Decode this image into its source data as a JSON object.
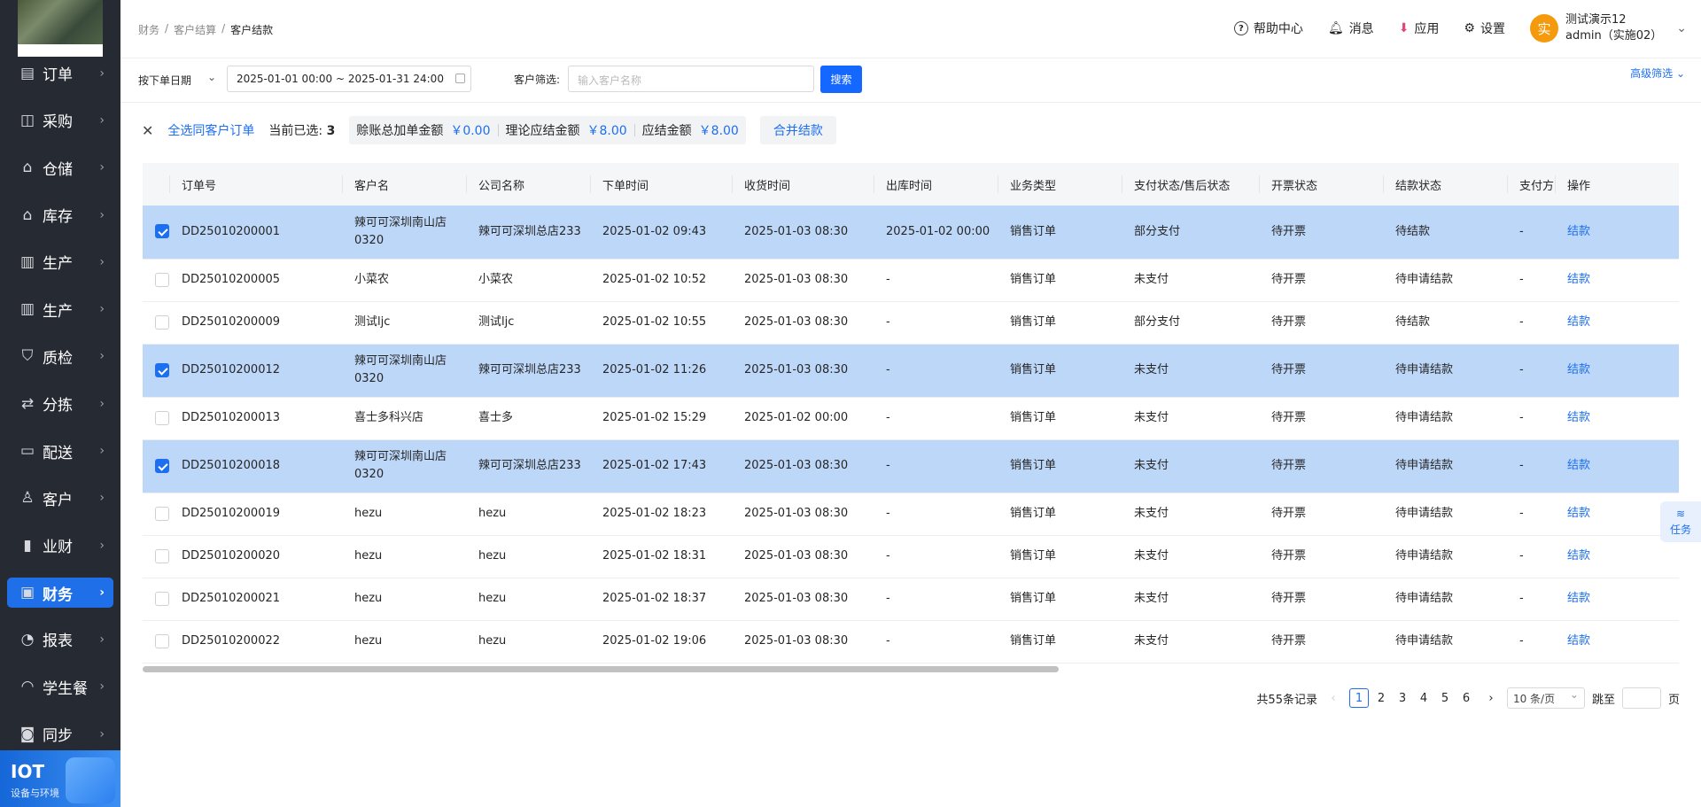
{
  "sidebar": {
    "items": [
      {
        "label": "订单",
        "icon": "clipboard-icon"
      },
      {
        "label": "采购",
        "icon": "shopping-bag-icon"
      },
      {
        "label": "仓储",
        "icon": "warehouse-icon"
      },
      {
        "label": "库存",
        "icon": "inventory-icon"
      },
      {
        "label": "生产",
        "icon": "factory-icon"
      },
      {
        "label": "生产",
        "icon": "factory-icon"
      },
      {
        "label": "质检",
        "icon": "shield-icon"
      },
      {
        "label": "分拣",
        "icon": "sort-icon"
      },
      {
        "label": "配送",
        "icon": "truck-icon"
      },
      {
        "label": "客户",
        "icon": "user-icon"
      },
      {
        "label": "业财",
        "icon": "chart-icon"
      },
      {
        "label": "财务",
        "icon": "wallet-icon",
        "active": true
      },
      {
        "label": "报表",
        "icon": "pie-icon"
      },
      {
        "label": "学生餐",
        "icon": "dish-icon"
      },
      {
        "label": "同步",
        "icon": "sync-icon"
      }
    ],
    "iot_title": "IOT",
    "iot_sub": "设备与环境"
  },
  "breadcrumb": [
    "财务",
    "客户结算",
    "客户结款"
  ],
  "header": {
    "help": "帮助中心",
    "messages": "消息",
    "apps": "应用",
    "settings": "设置",
    "avatar_char": "实",
    "user_name": "测试演示12",
    "user_role": "admin（实施02）"
  },
  "filters": {
    "date_type": "按下单日期",
    "date_range": "2025-01-01 00:00 ~ 2025-01-31 24:00",
    "customer_label": "客户筛选:",
    "customer_placeholder": "输入客户名称",
    "search": "搜索",
    "advanced": "高级筛选"
  },
  "selection": {
    "select_all": "全选同客户订单",
    "current_label": "当前已选:",
    "current_count": "3",
    "total_add_label": "赊账总加单金额",
    "total_add_value": "￥0.00",
    "theory_label": "理论应结金额",
    "theory_value": "￥8.00",
    "due_label": "应结金额",
    "due_value": "￥8.00",
    "merge": "合并结款"
  },
  "table": {
    "columns": [
      "订单号",
      "客户名",
      "公司名称",
      "下单时间",
      "收货时间",
      "出库时间",
      "业务类型",
      "支付状态/售后状态",
      "开票状态",
      "结款状态",
      "支付方",
      "操作"
    ],
    "rows": [
      {
        "checked": true,
        "order": "DD25010200001",
        "customer": "辣可可深圳南山店0320",
        "company": "辣可可深圳总店233",
        "order_time": "2025-01-02 09:43",
        "receive_time": "2025-01-03 08:30",
        "out_time": "2025-01-02 00:00",
        "biz": "销售订单",
        "pay": "部分支付",
        "invoice": "待开票",
        "settle": "待结款",
        "payer": "-",
        "action": "结款"
      },
      {
        "checked": false,
        "order": "DD25010200005",
        "customer": "小菜农",
        "company": "小菜农",
        "order_time": "2025-01-02 10:52",
        "receive_time": "2025-01-03 08:30",
        "out_time": "-",
        "biz": "销售订单",
        "pay": "未支付",
        "invoice": "待开票",
        "settle": "待申请结款",
        "payer": "-",
        "action": "结款"
      },
      {
        "checked": false,
        "order": "DD25010200009",
        "customer": "测试ljc",
        "company": "测试ljc",
        "order_time": "2025-01-02 10:55",
        "receive_time": "2025-01-03 08:30",
        "out_time": "-",
        "biz": "销售订单",
        "pay": "部分支付",
        "invoice": "待开票",
        "settle": "待结款",
        "payer": "-",
        "action": "结款"
      },
      {
        "checked": true,
        "order": "DD25010200012",
        "customer": "辣可可深圳南山店0320",
        "company": "辣可可深圳总店233",
        "order_time": "2025-01-02 11:26",
        "receive_time": "2025-01-03 08:30",
        "out_time": "-",
        "biz": "销售订单",
        "pay": "未支付",
        "invoice": "待开票",
        "settle": "待申请结款",
        "payer": "-",
        "action": "结款"
      },
      {
        "checked": false,
        "order": "DD25010200013",
        "customer": "喜士多科兴店",
        "company": "喜士多",
        "order_time": "2025-01-02 15:29",
        "receive_time": "2025-01-02 00:00",
        "out_time": "-",
        "biz": "销售订单",
        "pay": "未支付",
        "invoice": "待开票",
        "settle": "待申请结款",
        "payer": "-",
        "action": "结款"
      },
      {
        "checked": true,
        "order": "DD25010200018",
        "customer": "辣可可深圳南山店0320",
        "company": "辣可可深圳总店233",
        "order_time": "2025-01-02 17:43",
        "receive_time": "2025-01-03 08:30",
        "out_time": "-",
        "biz": "销售订单",
        "pay": "未支付",
        "invoice": "待开票",
        "settle": "待申请结款",
        "payer": "-",
        "action": "结款"
      },
      {
        "checked": false,
        "order": "DD25010200019",
        "customer": "hezu",
        "company": "hezu",
        "order_time": "2025-01-02 18:23",
        "receive_time": "2025-01-03 08:30",
        "out_time": "-",
        "biz": "销售订单",
        "pay": "未支付",
        "invoice": "待开票",
        "settle": "待申请结款",
        "payer": "-",
        "action": "结款"
      },
      {
        "checked": false,
        "order": "DD25010200020",
        "customer": "hezu",
        "company": "hezu",
        "order_time": "2025-01-02 18:31",
        "receive_time": "2025-01-03 08:30",
        "out_time": "-",
        "biz": "销售订单",
        "pay": "未支付",
        "invoice": "待开票",
        "settle": "待申请结款",
        "payer": "-",
        "action": "结款"
      },
      {
        "checked": false,
        "order": "DD25010200021",
        "customer": "hezu",
        "company": "hezu",
        "order_time": "2025-01-02 18:37",
        "receive_time": "2025-01-03 08:30",
        "out_time": "-",
        "biz": "销售订单",
        "pay": "未支付",
        "invoice": "待开票",
        "settle": "待申请结款",
        "payer": "-",
        "action": "结款"
      },
      {
        "checked": false,
        "order": "DD25010200022",
        "customer": "hezu",
        "company": "hezu",
        "order_time": "2025-01-02 19:06",
        "receive_time": "2025-01-03 08:30",
        "out_time": "-",
        "biz": "销售订单",
        "pay": "未支付",
        "invoice": "待开票",
        "settle": "待申请结款",
        "payer": "-",
        "action": "结款"
      }
    ]
  },
  "pagination": {
    "total": "共55条记录",
    "pages": [
      "1",
      "2",
      "3",
      "4",
      "5",
      "6"
    ],
    "current": "1",
    "page_size": "10 条/页",
    "jump_label": "跳至",
    "page_unit": "页"
  },
  "task_label": "任务"
}
